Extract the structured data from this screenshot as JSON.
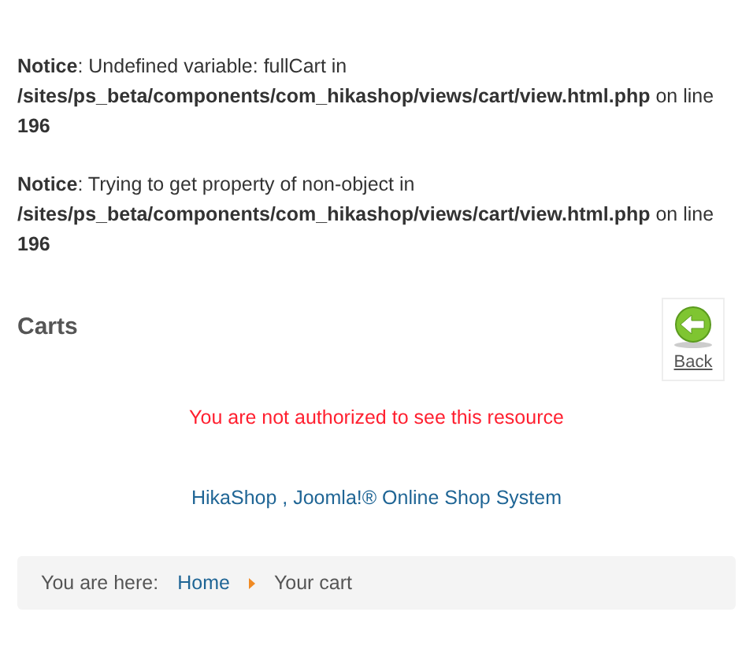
{
  "notices": [
    "**Notice**: Undefined variable: fullCart in **/sites/ps_beta/components/com_hikashop/views/cart/view.html.php** on line **196**",
    "**Notice**: Trying to get property of non-object in **/sites/ps_beta/components/com_hikashop/views/cart/view.html.php** on line **196**"
  ],
  "heading": "Carts",
  "back_button": {
    "label": "Back"
  },
  "error_message": "You are not authorized to see this resource",
  "footer_link": "HikaShop , Joomla!® Online Shop System",
  "breadcrumb": {
    "label": "You are here:",
    "items": [
      {
        "text": "Home",
        "kind": "link"
      },
      {
        "text": "Your cart",
        "kind": "current"
      }
    ]
  }
}
